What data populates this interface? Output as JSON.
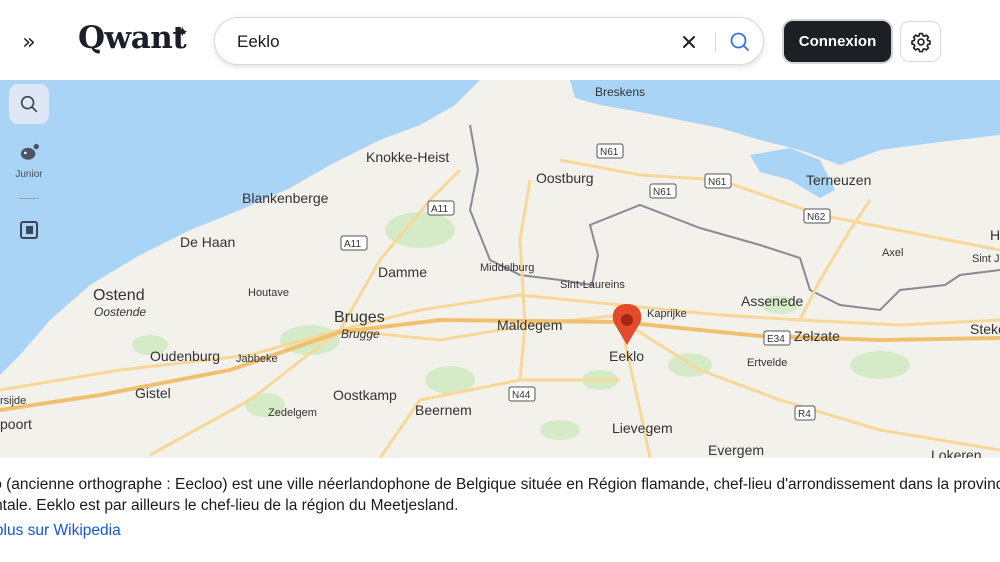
{
  "header": {
    "logo_text": "Qwant",
    "logo_star": "✦",
    "search_value": "Eeklo",
    "login_label": "Connexion",
    "icons": {
      "expand": "double-chevron-right-icon",
      "clear": "close-icon",
      "search": "search-icon",
      "settings": "gear-icon"
    },
    "colors": {
      "login_bg": "#1c1f24",
      "search_icon": "#3c6fe4"
    }
  },
  "sidebar": {
    "items": [
      {
        "name": "search",
        "icon": "search-icon",
        "active": true
      },
      {
        "name": "junior",
        "icon": "junior-icon",
        "label": "Junior"
      },
      {
        "name": "book",
        "icon": "book-icon"
      }
    ]
  },
  "map": {
    "colors": {
      "sea": "#a9d4f5",
      "land": "#f3f1ec",
      "green": "#d5ebc7",
      "road": "#f7d899"
    },
    "marker": {
      "label": "Eeklo",
      "color": "#e34b2c"
    },
    "places": {
      "breskens": "Breskens",
      "knokke": "Knokke-Heist",
      "oostburg": "Oostburg",
      "terneuzen": "Terneuzen",
      "blankenberge": "Blankenberge",
      "dehaan": "De Haan",
      "damme": "Damme",
      "middelburg": "Middelburg",
      "axel": "Axel",
      "sintjan": "Sint J",
      "sintlaureins": "Sint-Laureins",
      "assenede": "Assenede",
      "ostend": "Ostend",
      "oostende": "Oostende",
      "houtave": "Houtave",
      "bruges": "Bruges",
      "brugge": "Brugge",
      "maldegem": "Maldegem",
      "kaprijke": "Kaprijke",
      "zelzate": "Zelzate",
      "steke": "Steke",
      "oudenburg": "Oudenburg",
      "jabbeke": "Jabbeke",
      "ertvelde": "Ertvelde",
      "gistel": "Gistel",
      "oostkamp": "Oostkamp",
      "beernem": "Beernem",
      "zedelgem": "Zedelgem",
      "bredene": "rsijde",
      "nieuwpoort": "poort",
      "lievegem": "Lievegem",
      "evergem": "Evergem",
      "lokeren": "Lokeren",
      "h": "H"
    },
    "roads": {
      "n61a": "N61",
      "n61b": "N61",
      "n61c": "N61",
      "a11a": "A11",
      "a11b": "A11",
      "n62": "N62",
      "e34": "E34",
      "n44": "N44",
      "r4": "R4"
    }
  },
  "info": {
    "line1": "klo (ancienne orthographe : Eecloo) est une ville néerlandophone de Belgique située en Région flamande, chef-lieu d'arrondissement dans la province",
    "line2": "ientale. Eeklo est par ailleurs le chef-lieu de la région du Meetjesland.",
    "wiki_link": "e plus sur Wikipedia"
  }
}
